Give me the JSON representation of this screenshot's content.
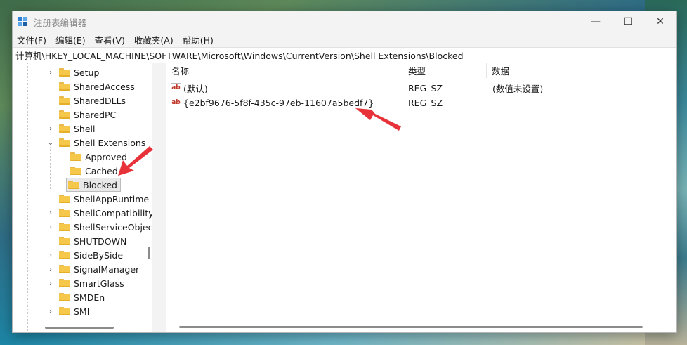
{
  "window": {
    "title": "注册表编辑器",
    "controls": [
      "—",
      "☐",
      "✕"
    ]
  },
  "menu": [
    "文件(F)",
    "编辑(E)",
    "查看(V)",
    "收藏夹(A)",
    "帮助(H)"
  ],
  "address": "计算机\\HKEY_LOCAL_MACHINE\\SOFTWARE\\Microsoft\\Windows\\CurrentVersion\\Shell Extensions\\Blocked",
  "tree": [
    {
      "label": "Setup",
      "expander": "›"
    },
    {
      "label": "SharedAccess",
      "expander": ""
    },
    {
      "label": "SharedDLLs",
      "expander": ""
    },
    {
      "label": "SharedPC",
      "expander": ""
    },
    {
      "label": "Shell",
      "expander": "›"
    },
    {
      "label": "Shell Extensions",
      "expander": "⌄"
    },
    {
      "label": "Approved",
      "expander": ""
    },
    {
      "label": "Cached",
      "expander": ""
    },
    {
      "label": "Blocked",
      "expander": "",
      "selected": true
    },
    {
      "label": "ShellAppRuntime",
      "expander": ""
    },
    {
      "label": "ShellCompatibility",
      "expander": "›"
    },
    {
      "label": "ShellServiceObjectD",
      "expander": "›"
    },
    {
      "label": "SHUTDOWN",
      "expander": ""
    },
    {
      "label": "SideBySide",
      "expander": "›"
    },
    {
      "label": "SignalManager",
      "expander": "›"
    },
    {
      "label": "SmartGlass",
      "expander": "›"
    },
    {
      "label": "SMDEn",
      "expander": ""
    },
    {
      "label": "SMI",
      "expander": "›"
    }
  ],
  "columns": {
    "name": "名称",
    "type": "类型",
    "data": "数据"
  },
  "values": [
    {
      "icon": "ab",
      "name": "(默认)",
      "type": "REG_SZ",
      "data": "(数值未设置)"
    },
    {
      "icon": "ab",
      "name": "{e2bf9676-5f8f-435c-97eb-11607a5bedf7}",
      "type": "REG_SZ",
      "data": ""
    }
  ],
  "colors": {
    "accent_arrow": "#e8323a",
    "folder": "#f5c84b"
  }
}
